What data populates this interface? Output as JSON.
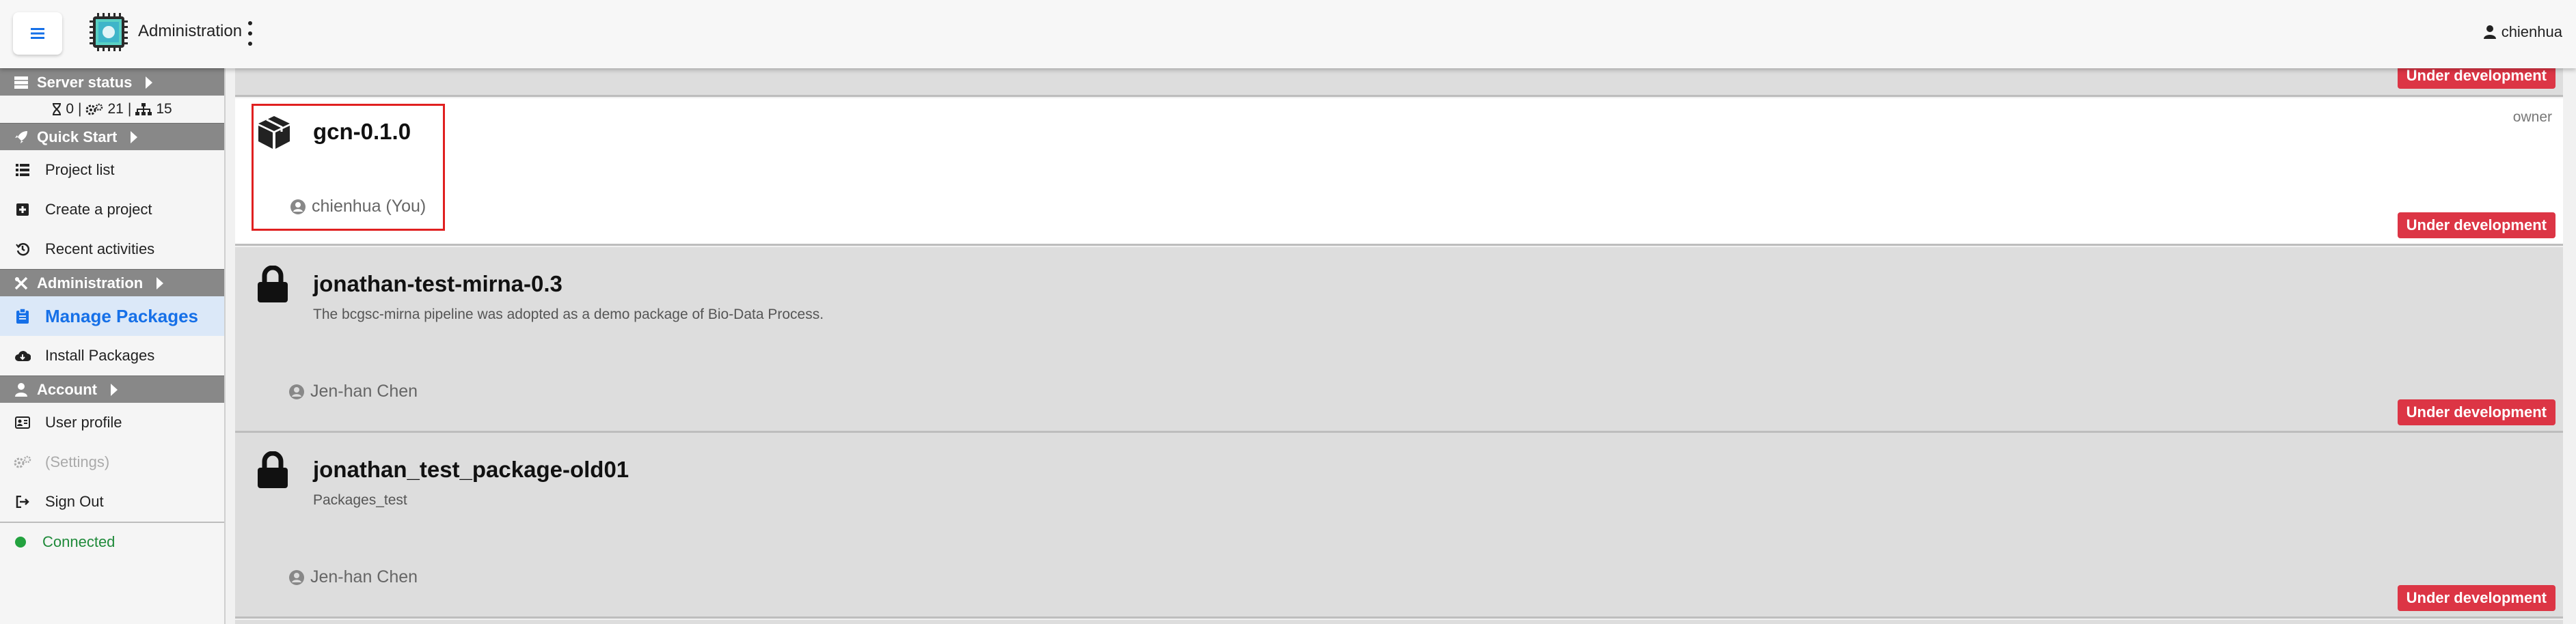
{
  "topbar": {
    "app_title": "Administration",
    "user_name": "chienhua"
  },
  "sidebar": {
    "server_status": {
      "label": "Server status",
      "hourglass_count": "0",
      "sep1": "|",
      "gears_count": "21",
      "sep2": "|",
      "nodes_count": "15"
    },
    "quick_start": {
      "label": "Quick Start",
      "items": [
        {
          "label": "Project list",
          "icon": "list-icon"
        },
        {
          "label": "Create a project",
          "icon": "plus-square-icon"
        },
        {
          "label": "Recent activities",
          "icon": "history-icon"
        }
      ]
    },
    "administration": {
      "label": "Administration",
      "items": [
        {
          "label": "Manage Packages",
          "icon": "clipboard-icon"
        },
        {
          "label": "Install Packages",
          "icon": "cloud-download-icon"
        }
      ]
    },
    "account": {
      "label": "Account",
      "items": [
        {
          "label": "User profile",
          "icon": "id-card-icon"
        },
        {
          "label": "(Settings)",
          "icon": "gears-icon"
        },
        {
          "label": "Sign Out",
          "icon": "sign-out-icon"
        }
      ]
    },
    "connection": "Connected"
  },
  "packages": [
    {
      "name": "gcn-0.1.0",
      "description": "",
      "author": "chienhua (You)",
      "role": "owner",
      "status": "Under development",
      "icon": "box-icon"
    },
    {
      "name": "jonathan-test-mirna-0.3",
      "description": "The bcgsc-mirna pipeline was adopted as a demo package of Bio-Data Process.",
      "author": "Jen-han Chen",
      "status": "Under development",
      "icon": "lock-icon"
    },
    {
      "name": "jonathan_test_package-old01",
      "description": "Packages_test",
      "author": "Jen-han Chen",
      "status": "Under development",
      "icon": "lock-icon"
    }
  ],
  "partial_top_card": {
    "status": "Under development"
  },
  "colors": {
    "accent": "#1670e8",
    "badge": "#dc3545",
    "section_header": "#888888",
    "connected": "#23a23f",
    "highlight": "#e02020"
  }
}
